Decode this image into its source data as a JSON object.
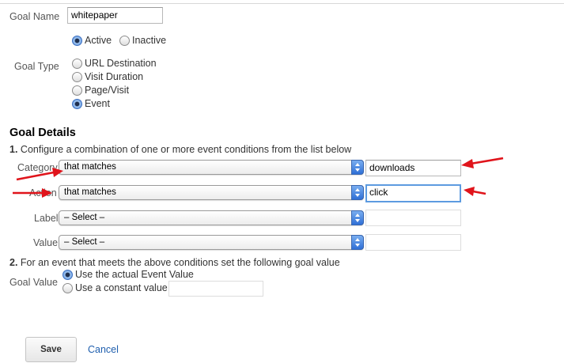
{
  "goal_name": {
    "label": "Goal Name",
    "value": "whitepaper"
  },
  "status": {
    "options": [
      {
        "label": "Active",
        "selected": true
      },
      {
        "label": "Inactive",
        "selected": false
      }
    ]
  },
  "goal_type": {
    "label": "Goal Type",
    "options": [
      {
        "label": "URL Destination",
        "selected": false
      },
      {
        "label": "Visit Duration",
        "selected": false
      },
      {
        "label": "Page/Visit",
        "selected": false
      },
      {
        "label": "Event",
        "selected": true
      }
    ]
  },
  "goal_details": {
    "heading": "Goal Details",
    "step1_number": "1.",
    "step1_text": "Configure a combination of one or more event conditions from the list below",
    "conditions": [
      {
        "label": "Category",
        "operator": "that matches",
        "value": "downloads"
      },
      {
        "label": "Action",
        "operator": "that matches",
        "value": "click"
      },
      {
        "label": "Label",
        "operator": "– Select –",
        "value": ""
      },
      {
        "label": "Value",
        "operator": "– Select –",
        "value": ""
      }
    ],
    "step2_number": "2.",
    "step2_text": "For an event that meets the above conditions set the following goal value",
    "goal_value": {
      "label": "Goal Value",
      "options": [
        {
          "label": "Use the actual Event Value",
          "selected": true
        },
        {
          "label": "Use a constant value",
          "selected": false
        }
      ],
      "constant_value": ""
    }
  },
  "actions": {
    "save_label": "Save",
    "cancel_label": "Cancel"
  },
  "colors": {
    "annotation_arrow": "#e0141b",
    "link": "#1f5fae",
    "focus_ring": "#5d9be0"
  }
}
